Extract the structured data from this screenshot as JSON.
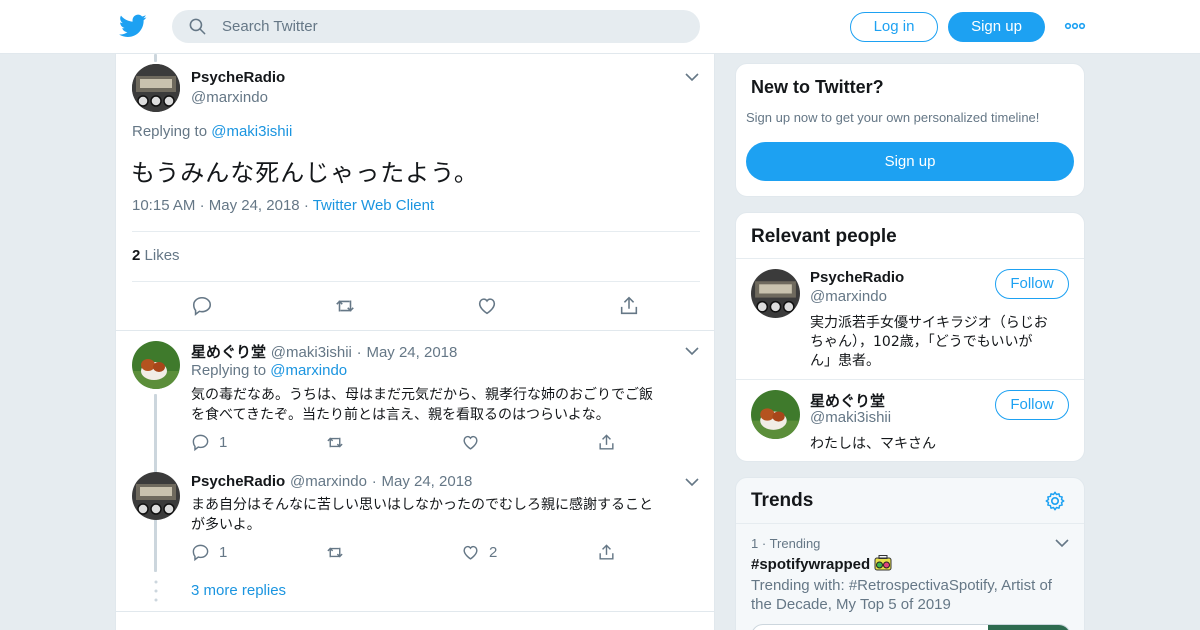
{
  "topbar": {
    "search_placeholder": "Search Twitter",
    "login_label": "Log in",
    "signup_label": "Sign up"
  },
  "main_tweet": {
    "name": "PsycheRadio",
    "handle": "@marxindo",
    "replying_prefix": "Replying to",
    "replying_to": "@maki3ishii",
    "text": "もうみんな死んじゃったよう。",
    "time": "10:15 AM",
    "date": "May 24, 2018",
    "client": "Twitter Web Client",
    "likes_count": "2",
    "likes_label": "Likes"
  },
  "replies": [
    {
      "name": "星めぐり堂",
      "handle": "@maki3ishii",
      "date": "May 24, 2018",
      "replying_prefix": "Replying to",
      "replying_to": "@marxindo",
      "text_line1": "気の毒だなあ。うちは、母はまだ元気だから、親孝行な姉のおごりでご飯",
      "text_line2": "を食べてきたぞ。当たり前とは言え、親を看取るのはつらいよな。",
      "reply_count": "1",
      "like_count": ""
    },
    {
      "name": "PsycheRadio",
      "handle": "@marxindo",
      "date": "May 24, 2018",
      "text_line1": "まあ自分はそんなに苦しい思いはしなかったのでむしろ親に感謝すること",
      "text_line2": "が多いよ。",
      "reply_count": "1",
      "like_count": "2"
    }
  ],
  "more_replies": "3 more replies",
  "sidebar": {
    "new_title": "New to Twitter?",
    "new_sub": "Sign up now to get your own personalized timeline!",
    "new_signup": "Sign up",
    "relevant_title": "Relevant people",
    "people": [
      {
        "name": "PsycheRadio",
        "handle": "@marxindo",
        "bio_line1": "実力派若手女優サイキラジオ（らじお",
        "bio_line2": "ちゃん），102歳，「どうでもいいが",
        "bio_line3": "ん」患者。",
        "follow": "Follow"
      },
      {
        "name": "星めぐり堂",
        "handle": "@maki3ishii",
        "bio_line1": "わたしは、マキさん",
        "follow": "Follow"
      }
    ],
    "trends_title": "Trends",
    "trend": {
      "rank": "1",
      "category": "Trending",
      "tag": "#spotifywrapped",
      "with_line1": "Trending with: #RetrospectivaSpotify, Artist of",
      "with_line2": "the Decade, My Top 5 of 2019"
    }
  },
  "colors": {
    "accent": "#1da1f2",
    "link": "#1b95e0",
    "muted": "#657786",
    "background": "#e6ecf0"
  }
}
